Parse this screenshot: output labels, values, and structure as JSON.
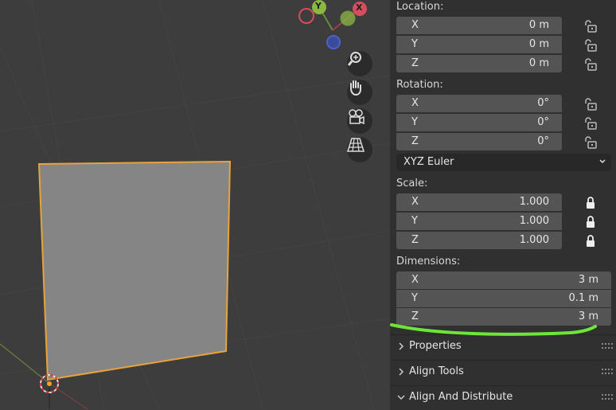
{
  "gizmo": {
    "y_label": "Y",
    "x_label": "X"
  },
  "nav_tools": [
    "zoom-icon",
    "hand-pan-icon",
    "camera-icon",
    "grid-perspective-icon"
  ],
  "location": {
    "label": "Location:",
    "rows": [
      {
        "axis": "X",
        "value": "0 m"
      },
      {
        "axis": "Y",
        "value": "0 m"
      },
      {
        "axis": "Z",
        "value": "0 m"
      }
    ]
  },
  "rotation": {
    "label": "Rotation:",
    "rows": [
      {
        "axis": "X",
        "value": "0°"
      },
      {
        "axis": "Y",
        "value": "0°"
      },
      {
        "axis": "Z",
        "value": "0°"
      }
    ],
    "mode": "XYZ Euler"
  },
  "scale": {
    "label": "Scale:",
    "rows": [
      {
        "axis": "X",
        "value": "1.000"
      },
      {
        "axis": "Y",
        "value": "1.000"
      },
      {
        "axis": "Z",
        "value": "1.000"
      }
    ]
  },
  "dimensions": {
    "label": "Dimensions:",
    "rows": [
      {
        "axis": "X",
        "value": "3 m"
      },
      {
        "axis": "Y",
        "value": "0.1 m"
      },
      {
        "axis": "Z",
        "value": "3 m"
      }
    ]
  },
  "panels": [
    "Properties",
    "Align Tools",
    "Align And Distribute"
  ],
  "colors": {
    "selection_outline": "#e8a33c",
    "annotation": "#6ee637",
    "axis_x": "#d94b5e",
    "axis_y": "#8bb843",
    "axis_z": "#4d62c9"
  }
}
